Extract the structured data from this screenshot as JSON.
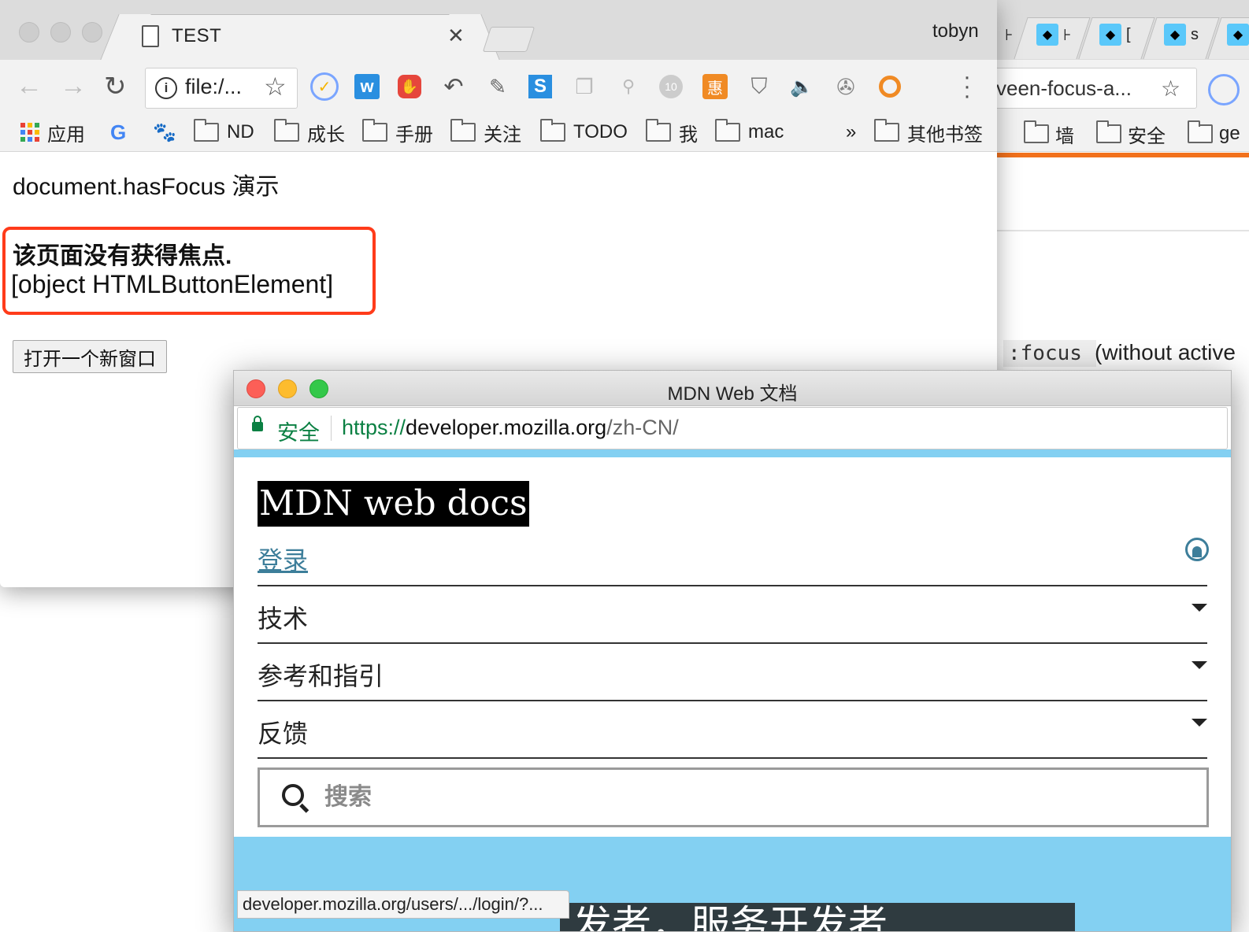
{
  "main_window": {
    "tab_title": "TEST",
    "profile_name": "tobyn",
    "omnibox_text": "file:/...",
    "bookmarks": [
      {
        "label": "应用",
        "kind": "apps"
      },
      {
        "label": "",
        "kind": "google"
      },
      {
        "label": "",
        "kind": "baidu"
      },
      {
        "label": "ND",
        "kind": "folder"
      },
      {
        "label": "成长",
        "kind": "folder"
      },
      {
        "label": "手册",
        "kind": "folder"
      },
      {
        "label": "关注",
        "kind": "folder"
      },
      {
        "label": "TODO",
        "kind": "folder"
      },
      {
        "label": "我",
        "kind": "folder"
      },
      {
        "label": "mac",
        "kind": "folder"
      }
    ],
    "bookmarks_overflow": "»",
    "other_bookmarks": "其他书签",
    "page": {
      "heading": "document.hasFocus 演示",
      "status": "该页面没有获得焦点.",
      "active_element": "[object HTMLButtonElement]",
      "button_label": "打开一个新窗口"
    }
  },
  "background_window": {
    "omnibox_text": "veen-focus-a...",
    "bookmarks": [
      "墙",
      "安全",
      "ge"
    ],
    "code_text": ":focus",
    "body_text": "(without active"
  },
  "popup_window": {
    "title": "MDN Web 文档",
    "secure_label": "安全",
    "url": {
      "scheme": "https://",
      "host": "developer.mozilla.org",
      "path": "/zh-CN/"
    },
    "logo": "MDN web docs",
    "login": "登录",
    "menu": [
      "技术",
      "参考和指引",
      "反馈"
    ],
    "search_placeholder": "搜索",
    "hero_text": "发者，服务开发者",
    "status_url": "developer.mozilla.org/users/.../login/?..."
  }
}
